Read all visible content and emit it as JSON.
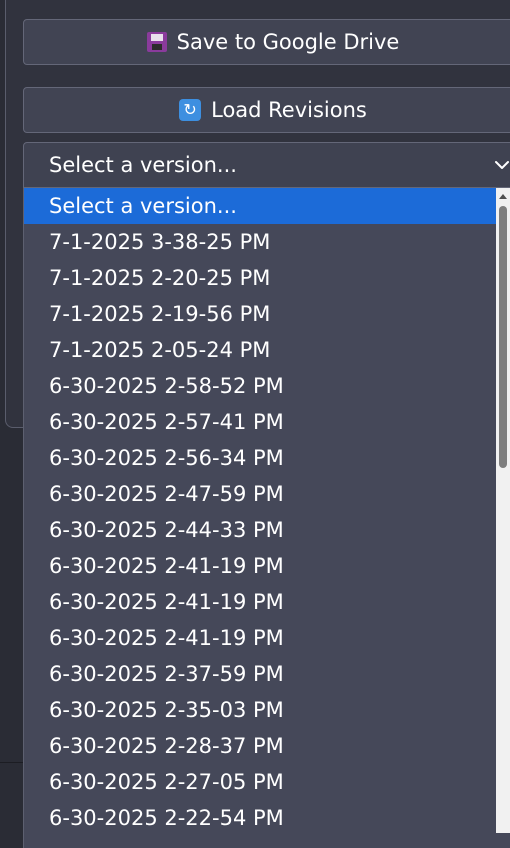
{
  "buttons": {
    "save_label": "Save to Google Drive",
    "load_label": "Load Revisions"
  },
  "icons": {
    "save": "floppy-disk-icon",
    "load": "refresh-icon",
    "select_arrow": "chevron-down-icon"
  },
  "select": {
    "current_value": "Select a version..."
  },
  "dropdown": {
    "options": [
      "Select a version...",
      "7-1-2025 3-38-25 PM",
      "7-1-2025 2-20-25 PM",
      "7-1-2025 2-19-56 PM",
      "7-1-2025 2-05-24 PM",
      "6-30-2025 2-58-52 PM",
      "6-30-2025 2-57-41 PM",
      "6-30-2025 2-56-34 PM",
      "6-30-2025 2-47-59 PM",
      "6-30-2025 2-44-33 PM",
      "6-30-2025 2-41-19 PM",
      "6-30-2025 2-41-19 PM",
      "6-30-2025 2-41-19 PM",
      "6-30-2025 2-37-59 PM",
      "6-30-2025 2-35-03 PM",
      "6-30-2025 2-28-37 PM",
      "6-30-2025 2-27-05 PM",
      "6-30-2025 2-22-54 PM"
    ],
    "highlighted_index": 0
  },
  "colors": {
    "page_background": "#2a2c35",
    "button_background": "#414453",
    "dropdown_background": "#454859",
    "highlight": "#1c6bd8"
  }
}
